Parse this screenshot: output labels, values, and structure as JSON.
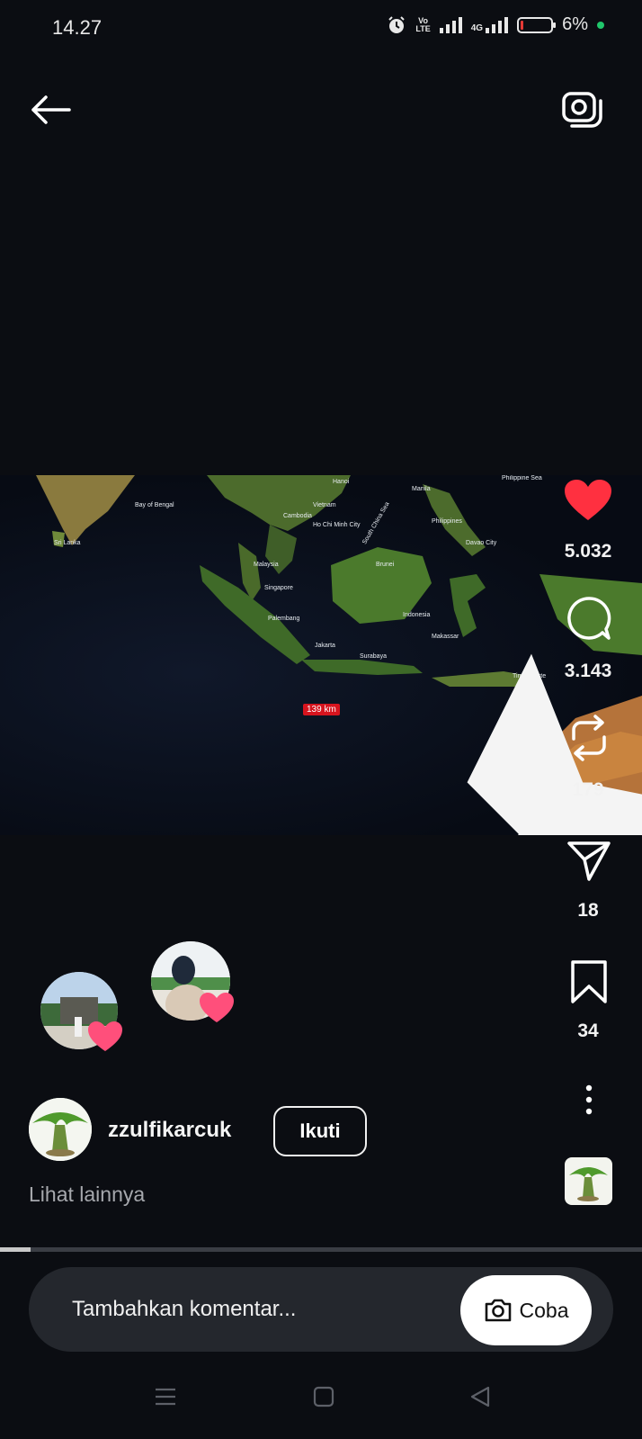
{
  "status_bar": {
    "time": "14.27",
    "volte_line1": "Vo",
    "volte_line2": "LTE",
    "network": "4G",
    "battery": "6%",
    "icons": [
      "alarm-icon",
      "signal-icon",
      "battery-icon"
    ]
  },
  "header": {
    "back_icon": "back-arrow-icon",
    "camera_icon": "camera-icon"
  },
  "map": {
    "labels": [
      "Sri Lanka",
      "Bay of Bengal",
      "Vietnam",
      "Cambodia",
      "Ho Chi Minh City",
      "Philippines",
      "Malaysia",
      "Singapore",
      "Brunei",
      "Palembang",
      "Indonesia",
      "Jakarta",
      "Surabaya",
      "Makassar",
      "Timor-Leste",
      "Davao City",
      "Manila",
      "Philippine Sea",
      "South China Sea",
      "Hanoi"
    ],
    "distance": "139 km"
  },
  "actions": {
    "likes": "5.032",
    "comments": "3.143",
    "reposts": "179",
    "shares": "18",
    "saves": "34"
  },
  "post": {
    "username": "zzulfikarcuk",
    "follow_label": "Ikuti",
    "see_more": "Lihat lainnya"
  },
  "progress": {
    "fraction": 0.047
  },
  "comment": {
    "placeholder": "Tambahkan komentar...",
    "try_label": "Coba"
  },
  "colors": {
    "background": "#0b0d12",
    "like_red": "#ff3040",
    "comment_bar": "#24272d",
    "muted_text": "#a6a8ad"
  }
}
